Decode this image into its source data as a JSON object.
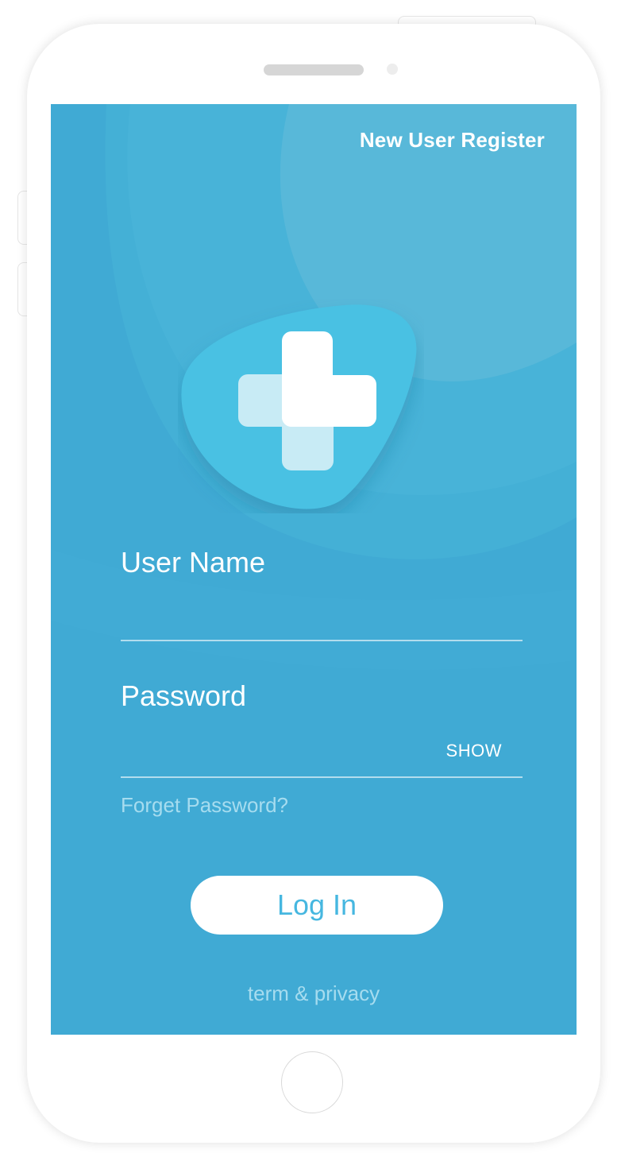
{
  "header": {
    "register_link": "New User Register"
  },
  "logo": {
    "icon": "medical-cross-icon"
  },
  "form": {
    "username_label": "User Name",
    "username_value": "",
    "password_label": "Password",
    "password_value": "",
    "show_toggle": "SHOW",
    "forgot_link": "Forget Password?"
  },
  "actions": {
    "login_label": "Log In"
  },
  "footer": {
    "terms_link": "term & privacy"
  },
  "colors": {
    "screen_background": "#40aad4",
    "accent": "#46b7e0",
    "muted_link": "#a6dcef"
  }
}
